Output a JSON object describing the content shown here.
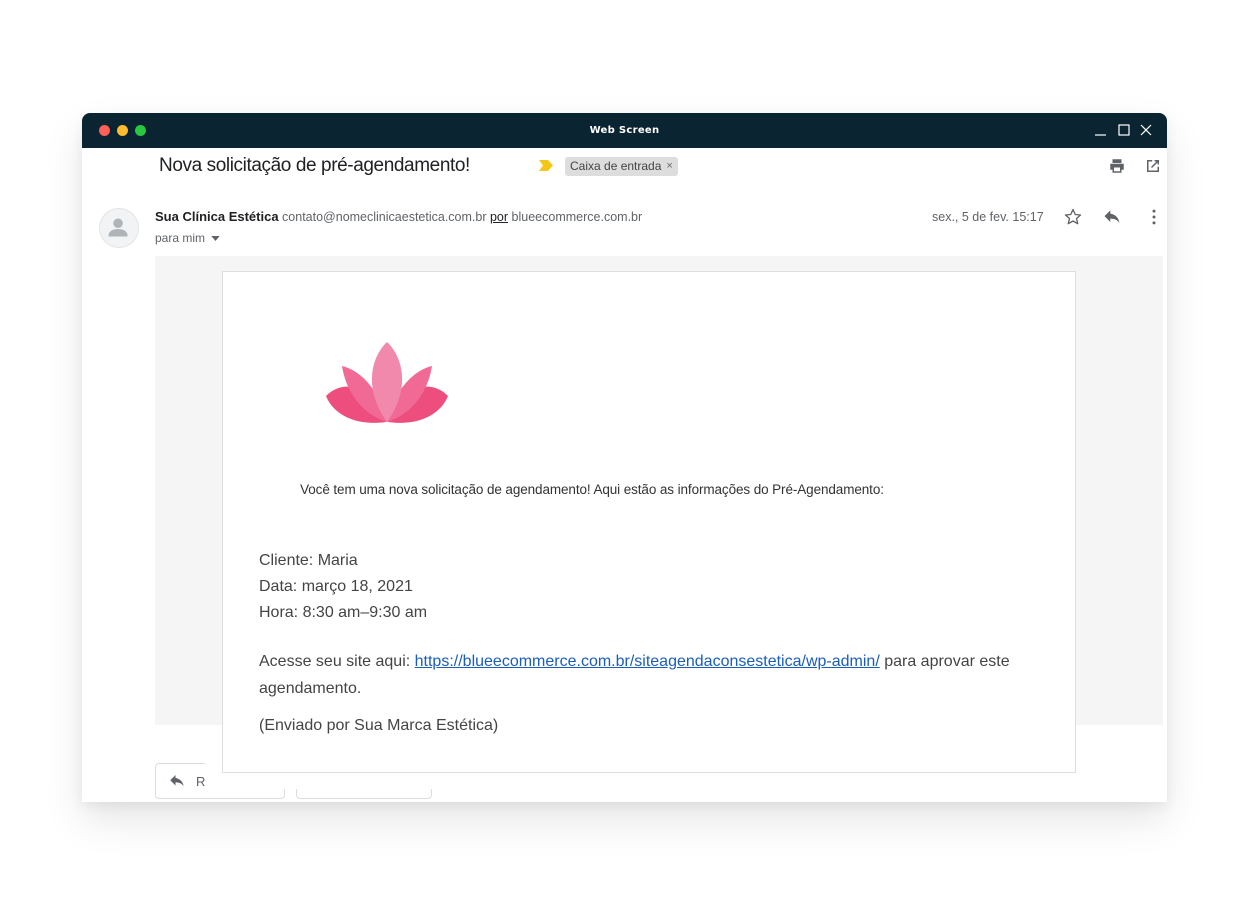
{
  "window": {
    "title": "Web Screen"
  },
  "email": {
    "subject": "Nova solicitação de pré-agendamento!",
    "label": "Caixa de entrada",
    "label_close": "×",
    "sender_name": "Sua Clínica Estética",
    "sender_email": "contato@nomeclinicaestetica.com.br",
    "via": "por",
    "via_domain": "blueecommerce.com.br",
    "to": "para mim",
    "date": "sex., 5 de fev. 15:17",
    "body": {
      "intro": "Você tem uma nova solicitação de agendamento! Aqui estão as informações do Pré-Agendamento:",
      "cliente": "Cliente: Maria",
      "data": "Data: março 18, 2021",
      "hora": "Hora: 8:30 am–9:30 am",
      "access_prefix": "Acesse seu site aqui: ",
      "access_link": "https://blueecommerce.com.br/siteagendaconsestetica/wp-admin/",
      "access_suffix": " para aprovar este agendamento.",
      "sent_by": "(Enviado por Sua Marca Estética)"
    },
    "reply_button": "R"
  },
  "icons": {
    "print": "print-icon",
    "open": "open-in-new-window-icon",
    "star": "star-icon",
    "reply": "reply-icon",
    "more": "more-vert-icon",
    "avatar": "person-icon",
    "label_arrow": "important-marker-icon",
    "logo": "lotus-icon"
  },
  "colors": {
    "titlebar": "#0b2431",
    "link": "#1a5dbd",
    "lotus": "#ee5b8a",
    "marker": "#f5c518"
  }
}
